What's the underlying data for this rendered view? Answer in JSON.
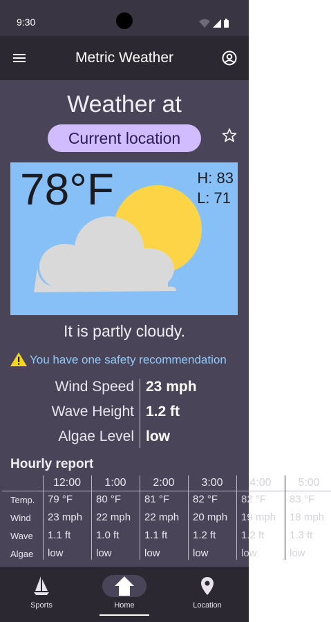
{
  "status_bar": {
    "time": "9:30"
  },
  "app_bar": {
    "title": "Metric Weather",
    "menu_icon": "hamburger-menu-icon",
    "account_icon": "account-circle-icon"
  },
  "location": {
    "heading": "Weather at",
    "chip_label": "Current location",
    "favorite_icon": "star-outline-icon"
  },
  "current": {
    "temperature": "78°F",
    "high": "H: 83",
    "low": "L: 71",
    "condition_text": "It is partly cloudy.",
    "illustration": "partly-cloudy"
  },
  "safety": {
    "text": "You have one safety recommendation",
    "icon": "warning-icon"
  },
  "metrics": [
    {
      "label": "Wind Speed",
      "value": "23 mph"
    },
    {
      "label": "Wave Height",
      "value": "1.2 ft"
    },
    {
      "label": "Algae Level",
      "value": "low"
    }
  ],
  "hourly": {
    "title": "Hourly report",
    "row_labels": [
      "Temp.",
      "Wind",
      "Wave",
      "Algae"
    ],
    "columns": [
      {
        "time": "12:00",
        "temp": "79 °F",
        "wind": "23 mph",
        "wave": "1.1 ft",
        "algae": "low"
      },
      {
        "time": "1:00",
        "temp": "80 °F",
        "wind": "22 mph",
        "wave": "1.0 ft",
        "algae": "low"
      },
      {
        "time": "2:00",
        "temp": "81 °F",
        "wind": "22 mph",
        "wave": "1.1 ft",
        "algae": "low"
      },
      {
        "time": "3:00",
        "temp": "82 °F",
        "wind": "20 mph",
        "wave": "1.2 ft",
        "algae": "low"
      },
      {
        "time": "4:00",
        "temp": "82 °F",
        "wind": "19 mph",
        "wave": "1.2 ft",
        "algae": "low"
      },
      {
        "time": "5:00",
        "temp": "83 °F",
        "wind": "18 mph",
        "wave": "1.3 ft",
        "algae": "low"
      }
    ]
  },
  "bottom_nav": {
    "items": [
      {
        "label": "Sports",
        "icon": "sailboat-icon"
      },
      {
        "label": "Home",
        "icon": "home-icon",
        "selected": true
      },
      {
        "label": "Location",
        "icon": "location-pin-icon"
      }
    ]
  },
  "colors": {
    "background": "#4a4458",
    "app_bar": "#2c2831",
    "chip": "#d0bcff",
    "sky": "#87bff7",
    "sun": "#fdd445",
    "cloud": "#d9d9d9",
    "link": "#90caf9",
    "warning": "#f7d51d"
  }
}
